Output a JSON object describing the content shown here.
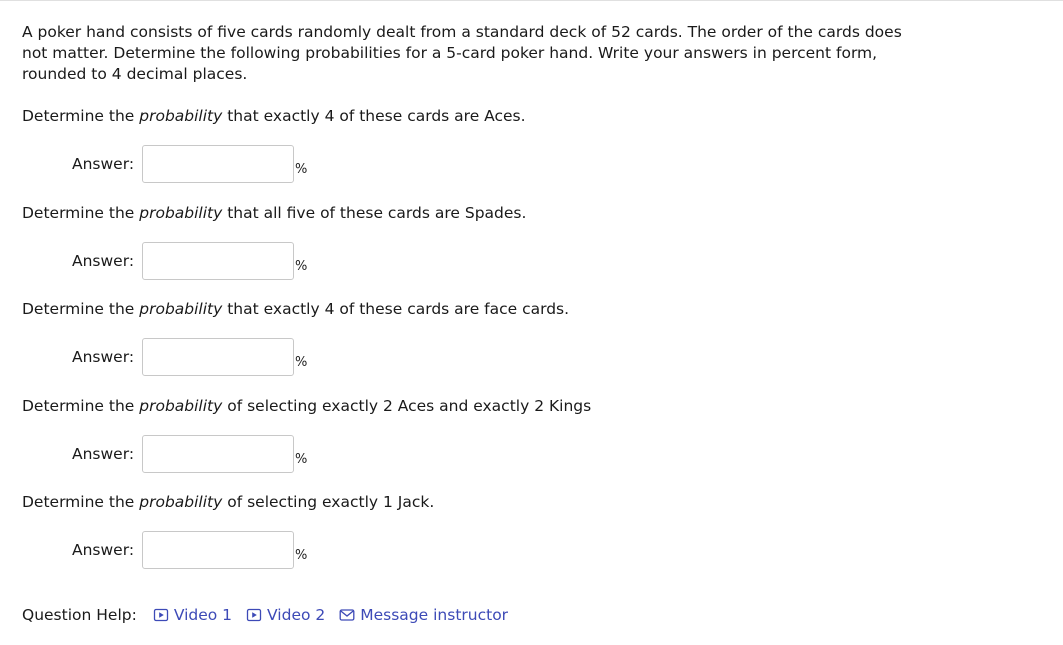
{
  "intro": "A poker hand consists of five cards randomly dealt from a standard deck of 52 cards. The order of the cards does not matter. Determine the following probabilities for a 5-card poker hand. Write your answers in percent form, rounded to 4 decimal places.",
  "questions": [
    {
      "prefix": "Determine the ",
      "emph": "probability",
      "suffix": " that exactly 4 of these cards are Aces.",
      "answer_label": "Answer:",
      "answer_value": "",
      "unit": "%"
    },
    {
      "prefix": "Determine the ",
      "emph": "probability",
      "suffix": " that all five of these cards are Spades.",
      "answer_label": "Answer:",
      "answer_value": "",
      "unit": "%"
    },
    {
      "prefix": "Determine the ",
      "emph": "probability",
      "suffix": " that exactly 4 of these cards are face cards.",
      "answer_label": "Answer:",
      "answer_value": "",
      "unit": "%"
    },
    {
      "prefix": "Determine the ",
      "emph": "probability",
      "suffix": " of selecting exactly 2 Aces and exactly 2 Kings",
      "answer_label": "Answer:",
      "answer_value": "",
      "unit": "%"
    },
    {
      "prefix": "Determine the ",
      "emph": "probability",
      "suffix": " of selecting exactly 1 Jack.",
      "answer_label": "Answer:",
      "answer_value": "",
      "unit": "%"
    }
  ],
  "help": {
    "label": "Question Help:",
    "links": [
      {
        "label": "Video 1",
        "icon": "play-icon"
      },
      {
        "label": "Video 2",
        "icon": "play-icon"
      },
      {
        "label": "Message instructor",
        "icon": "envelope-icon"
      }
    ]
  },
  "colors": {
    "text": "#1a1a1a",
    "link": "#3d4ab7",
    "input_border": "#c8c8c8"
  }
}
